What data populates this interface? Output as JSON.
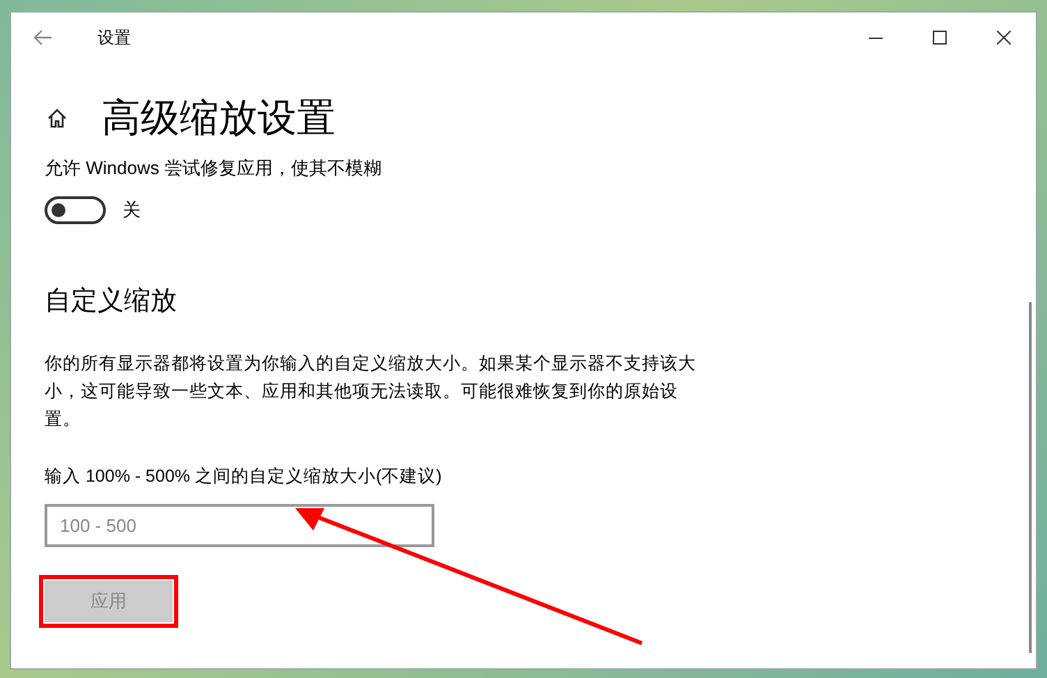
{
  "window": {
    "title": "设置"
  },
  "page_title": "高级缩放设置",
  "fix_apps": {
    "label": "允许 Windows 尝试修复应用，使其不模糊",
    "on": false,
    "state_text": "关"
  },
  "custom_scaling": {
    "heading": "自定义缩放",
    "description": "你的所有显示器都将设置为你输入的自定义缩放大小。如果某个显示器不支持该大小，这可能导致一些文本、应用和其他项无法读取。可能很难恢复到你的原始设置。",
    "field_label": "输入 100% - 500% 之间的自定义缩放大小(不建议)",
    "placeholder": "100 - 500",
    "apply_button": {
      "label": "应用",
      "disabled": true
    }
  }
}
